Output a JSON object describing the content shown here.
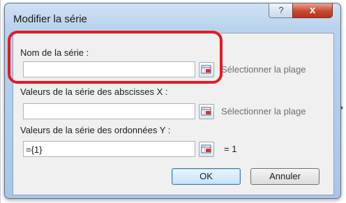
{
  "dialog": {
    "title": "Modifier la série",
    "help_symbol": "?",
    "close_symbol": "x"
  },
  "fields": {
    "name": {
      "label": "Nom de la série :",
      "value": "",
      "hint": "Sélectionner la plage"
    },
    "x_values": {
      "label": "Valeurs de la série des abscisses X :",
      "value": "",
      "hint": "Sélectionner la plage"
    },
    "y_values": {
      "label": "Valeurs de la série des ordonnées Y :",
      "value": "={1}",
      "result": "= 1"
    }
  },
  "buttons": {
    "ok": "OK",
    "cancel": "Annuler"
  },
  "colors": {
    "highlight": "#e31b23",
    "title_bar": "#b9d2ec",
    "close_button": "#c7472f"
  },
  "icons": [
    "range-picker-icon",
    "help-icon",
    "close-icon"
  ]
}
